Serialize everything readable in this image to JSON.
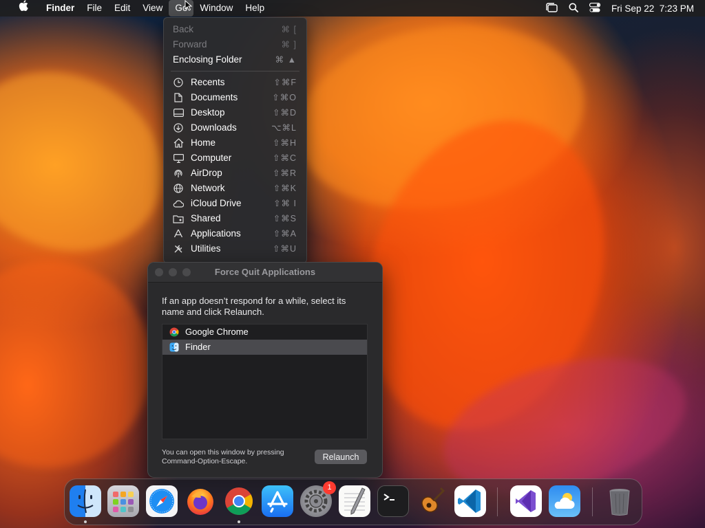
{
  "menubar": {
    "app": "Finder",
    "items": [
      "File",
      "Edit",
      "View",
      "Go",
      "Window",
      "Help"
    ],
    "clock": "Fri Sep 22  7:23 PM"
  },
  "go_menu": {
    "top_items": [
      {
        "label": "Back",
        "shortcut": "⌘ [",
        "disabled": true
      },
      {
        "label": "Forward",
        "shortcut": "⌘ ]",
        "disabled": true
      },
      {
        "label": "Enclosing Folder",
        "shortcut": "⌘ ▲",
        "disabled": false
      }
    ],
    "places": [
      {
        "label": "Recents",
        "shortcut": "⇧⌘F",
        "icon": "clock-icon"
      },
      {
        "label": "Documents",
        "shortcut": "⇧⌘O",
        "icon": "document-icon"
      },
      {
        "label": "Desktop",
        "shortcut": "⇧⌘D",
        "icon": "desktop-icon"
      },
      {
        "label": "Downloads",
        "shortcut": "⌥⌘L",
        "icon": "download-icon"
      },
      {
        "label": "Home",
        "shortcut": "⇧⌘H",
        "icon": "home-icon"
      },
      {
        "label": "Computer",
        "shortcut": "⇧⌘C",
        "icon": "computer-icon"
      },
      {
        "label": "AirDrop",
        "shortcut": "⇧⌘R",
        "icon": "airdrop-icon"
      },
      {
        "label": "Network",
        "shortcut": "⇧⌘K",
        "icon": "globe-icon"
      },
      {
        "label": "iCloud Drive",
        "shortcut": "⇧⌘ I",
        "icon": "cloud-icon"
      },
      {
        "label": "Shared",
        "shortcut": "⇧⌘S",
        "icon": "shared-folder-icon"
      },
      {
        "label": "Applications",
        "shortcut": "⇧⌘A",
        "icon": "apps-icon"
      },
      {
        "label": "Utilities",
        "shortcut": "⇧⌘U",
        "icon": "utilities-icon"
      }
    ]
  },
  "force_quit": {
    "title": "Force Quit Applications",
    "description": "If an app doesn’t respond for a while, select its name and click Relaunch.",
    "apps": [
      {
        "name": "Google Chrome",
        "selected": false
      },
      {
        "name": "Finder",
        "selected": true
      }
    ],
    "footer_line1": "You can open this window by pressing",
    "footer_line2": "Command-Option-Escape.",
    "button": "Relaunch"
  },
  "dock": {
    "items": [
      "Finder",
      "Launchpad",
      "Safari",
      "Firefox",
      "Google Chrome",
      "App Store",
      "System Settings",
      "TextEdit",
      "Terminal",
      "GarageBand",
      "Visual Studio Code",
      "Visual Studio",
      "Weather",
      "Trash"
    ],
    "settings_badge": "1"
  }
}
